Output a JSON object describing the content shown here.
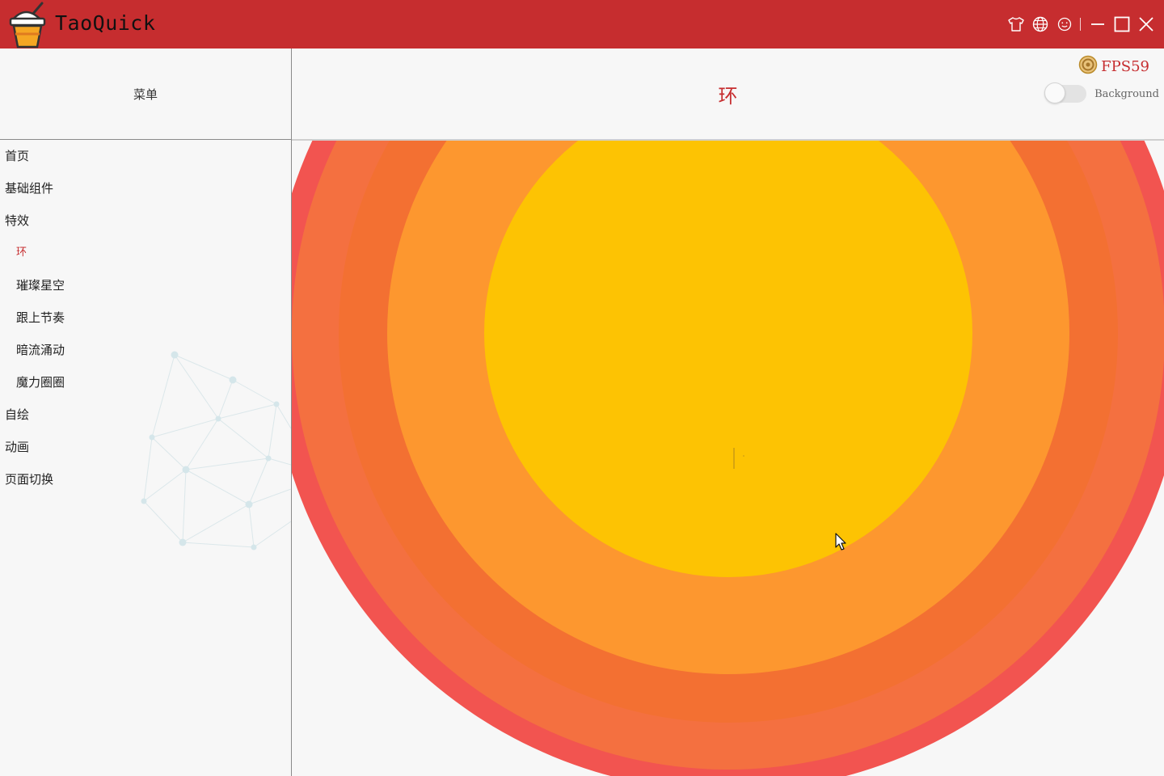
{
  "app": {
    "title": "TaoQuick",
    "accent_color": "#c62d2f"
  },
  "titlebar": {
    "buttons": [
      {
        "name": "skin-icon"
      },
      {
        "name": "language-icon"
      },
      {
        "name": "about-icon"
      },
      {
        "name": "minimize-icon"
      },
      {
        "name": "maximize-icon"
      },
      {
        "name": "close-icon"
      }
    ]
  },
  "sidebar": {
    "header": "菜单",
    "items": [
      {
        "label": "首页",
        "level": 0,
        "active": false
      },
      {
        "label": "基础组件",
        "level": 0,
        "active": false
      },
      {
        "label": "特效",
        "level": 0,
        "active": false
      },
      {
        "label": "环",
        "level": 1,
        "active": true
      },
      {
        "label": "璀璨星空",
        "level": 1,
        "active": false
      },
      {
        "label": "跟上节奏",
        "level": 1,
        "active": false
      },
      {
        "label": "暗流涌动",
        "level": 1,
        "active": false
      },
      {
        "label": "魔力圈圈",
        "level": 1,
        "active": false
      },
      {
        "label": "自绘",
        "level": 0,
        "active": false
      },
      {
        "label": "动画",
        "level": 0,
        "active": false
      },
      {
        "label": "页面切换",
        "level": 0,
        "active": false
      }
    ]
  },
  "content": {
    "page_title": "环",
    "fps_label": "FPS59",
    "background_toggle": {
      "label": "Background",
      "on": false
    },
    "ring_colors": [
      "#f25450",
      "#f47040",
      "#f37032",
      "#fd972f",
      "#fdc303"
    ]
  }
}
